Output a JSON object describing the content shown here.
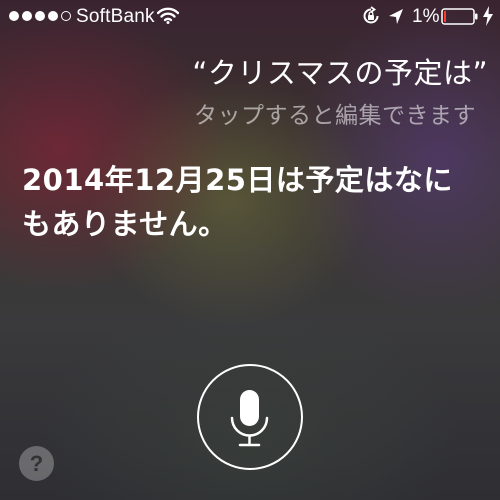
{
  "status_bar": {
    "signal_bars_filled": 4,
    "signal_bars_total": 5,
    "carrier": "SoftBank",
    "battery_percent": "1%",
    "battery_level": 0.01,
    "battery_color": "#ff3b30",
    "icons": [
      "wifi-icon",
      "orientation-lock-icon",
      "location-arrow-icon",
      "battery-icon",
      "charging-bolt-icon"
    ]
  },
  "siri": {
    "query": "“クリスマスの予定は”",
    "hint": "タップすると編集できます",
    "response": "2014年12月25日は予定はなにもありません。",
    "mic_icon": "microphone-icon",
    "help_label": "?"
  }
}
